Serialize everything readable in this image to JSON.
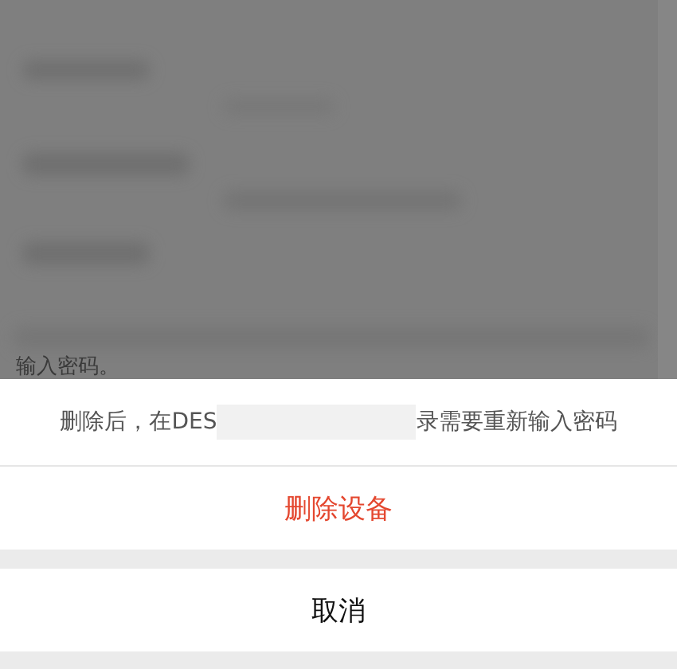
{
  "background": {
    "cut_text": "输入密码。"
  },
  "action_sheet": {
    "message_start": "删除后，在DES",
    "redacted": true,
    "message_end": "录需要重新输入密码",
    "actions": [
      {
        "label": "删除设备",
        "kind": "destructive"
      }
    ],
    "cancel": {
      "label": "取消"
    }
  }
}
